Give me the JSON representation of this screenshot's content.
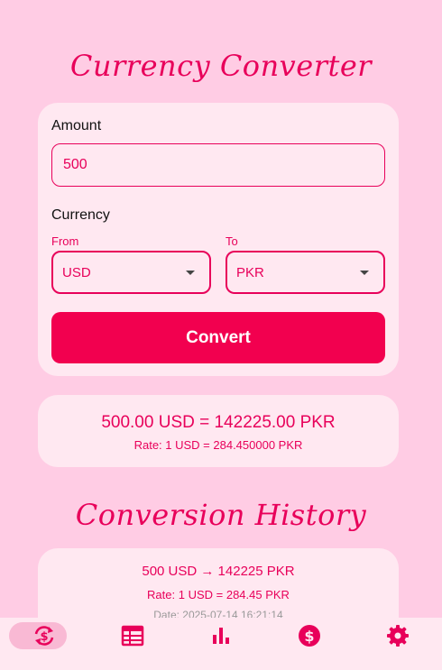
{
  "header": {
    "title": "Currency Converter"
  },
  "form": {
    "amount_label": "Amount",
    "amount_value": "500",
    "currency_label": "Currency",
    "from_label": "From",
    "from_value": "USD",
    "to_label": "To",
    "to_value": "PKR",
    "convert_label": "Convert"
  },
  "result": {
    "summary": "500.00 USD = 142225.00 PKR",
    "rate": "Rate: 1 USD = 284.450000 PKR"
  },
  "history": {
    "title": "Conversion History",
    "items": [
      {
        "summary": "500 USD → 142225 PKR",
        "rate": "Rate: 1 USD = 284.45 PKR",
        "date": "Date: 2025-07-14 16:21:14"
      }
    ]
  },
  "nav": {
    "items": [
      {
        "icon": "currency-exchange-icon",
        "active": true
      },
      {
        "icon": "table-icon",
        "active": false
      },
      {
        "icon": "bar-chart-icon",
        "active": false
      },
      {
        "icon": "dollar-icon",
        "active": false
      },
      {
        "icon": "gear-icon",
        "active": false
      }
    ]
  },
  "colors": {
    "background": "#ffcce4",
    "card": "#ffe8f1",
    "accent": "#f2004f",
    "text_accent": "#e8005a"
  }
}
